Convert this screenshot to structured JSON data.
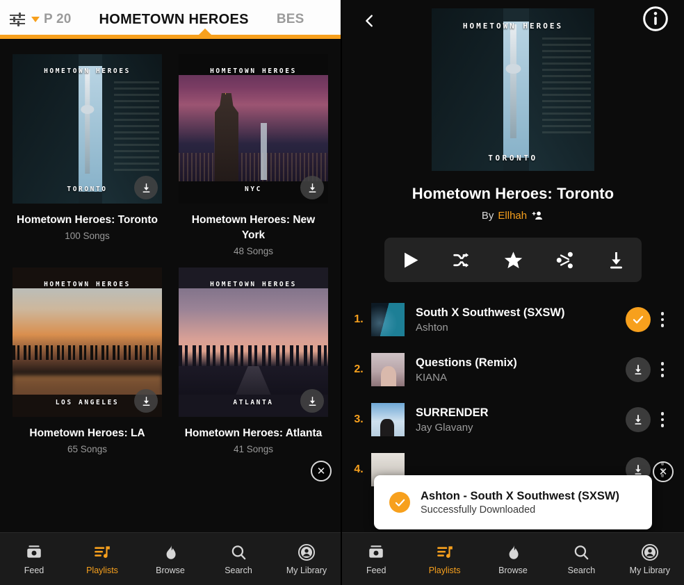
{
  "accent": "#F7A01D",
  "left": {
    "header": {
      "filter_icon": "sliders-icon",
      "caret_icon": "chevron-down-icon",
      "tabs": [
        {
          "label": "P 20",
          "active": false
        },
        {
          "label": "HOMETOWN HEROES",
          "active": true
        },
        {
          "label": "BES",
          "active": false
        }
      ]
    },
    "cards": [
      {
        "brand": "HOMETOWN HEROES",
        "city": "TORONTO",
        "title": "Hometown Heroes: Toronto",
        "songs": "100 Songs",
        "download_icon": "download-icon"
      },
      {
        "brand": "HOMETOWN HEROES",
        "city": "NYC",
        "title": "Hometown Heroes: New York",
        "songs": "48 Songs",
        "download_icon": "download-icon"
      },
      {
        "brand": "HOMETOWN HEROES",
        "city": "LOS ANGELES",
        "title": "Hometown Heroes: LA",
        "songs": "65 Songs",
        "download_icon": "download-icon"
      },
      {
        "brand": "HOMETOWN HEROES",
        "city": "ATLANTA",
        "title": "Hometown Heroes: Atlanta",
        "songs": "41 Songs",
        "download_icon": "download-icon"
      }
    ],
    "close_icon": "close-icon"
  },
  "right": {
    "back_icon": "back-chevron-icon",
    "info_icon": "info-icon",
    "cover": {
      "brand": "HOMETOWN HEROES",
      "city": "TORONTO"
    },
    "title": "Hometown Heroes: Toronto",
    "by_prefix": "By",
    "author": "Ellhah",
    "follow_icon": "add-person-icon",
    "actions": [
      {
        "name": "play-button",
        "icon": "play-icon"
      },
      {
        "name": "shuffle-button",
        "icon": "shuffle-icon"
      },
      {
        "name": "favorite-button",
        "icon": "star-icon"
      },
      {
        "name": "share-button",
        "icon": "share-icon"
      },
      {
        "name": "download-button",
        "icon": "download-icon"
      }
    ],
    "tracks": [
      {
        "num": "1.",
        "title": "South X Southwest (SXSW)",
        "artist": "Ashton",
        "state": "downloaded",
        "action_icon": "check-icon",
        "menu_icon": "kebab-menu-icon"
      },
      {
        "num": "2.",
        "title": "Questions (Remix)",
        "artist": "KIANA",
        "state": "available",
        "action_icon": "download-icon",
        "menu_icon": "kebab-menu-icon"
      },
      {
        "num": "3.",
        "title": "SURRENDER",
        "artist": "Jay Glavany",
        "state": "available",
        "action_icon": "download-icon",
        "menu_icon": "kebab-menu-icon"
      },
      {
        "num": "4.",
        "title": "",
        "artist": "",
        "state": "available",
        "action_icon": "download-icon",
        "menu_icon": "kebab-menu-icon"
      }
    ],
    "close_icon": "close-icon",
    "toast": {
      "check_icon": "check-icon",
      "title": "Ashton - South X Southwest (SXSW)",
      "subtitle": "Successfully Downloaded"
    }
  },
  "bottom_nav": [
    {
      "label": "Feed",
      "icon": "feed-icon",
      "active": false
    },
    {
      "label": "Playlists",
      "icon": "playlists-icon",
      "active": true
    },
    {
      "label": "Browse",
      "icon": "flame-icon",
      "active": false
    },
    {
      "label": "Search",
      "icon": "search-icon",
      "active": false
    },
    {
      "label": "My Library",
      "icon": "account-icon",
      "active": false
    }
  ]
}
